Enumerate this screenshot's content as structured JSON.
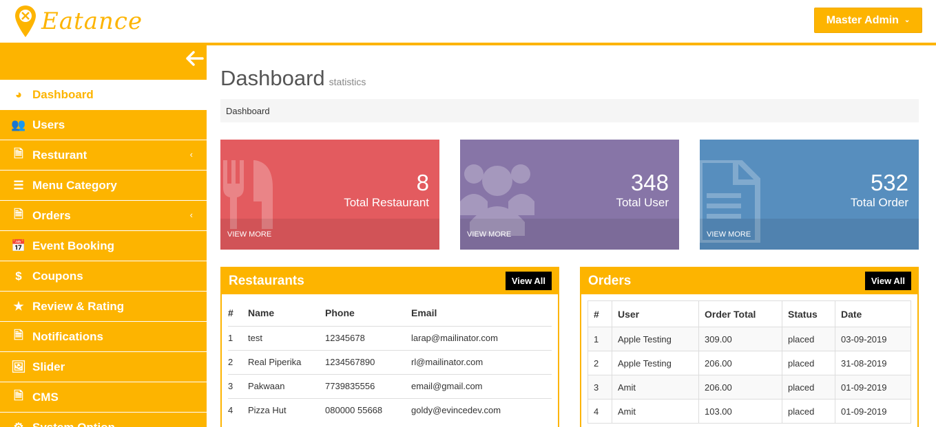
{
  "brand": {
    "name": "Eatance",
    "accent": "#fdb400"
  },
  "header": {
    "admin_label": "Master Admin",
    "admin_caret": "⌄"
  },
  "sidebar": {
    "toggle_icon": "arrow-left-icon",
    "items": [
      {
        "label": "Dashboard",
        "icon": "◕",
        "active": true
      },
      {
        "label": "Users",
        "icon": "👥"
      },
      {
        "label": "Resturant",
        "icon": "🗎",
        "chevron": "‹"
      },
      {
        "label": "Menu Category",
        "icon": "☰"
      },
      {
        "label": "Orders",
        "icon": "🗎",
        "chevron": "‹"
      },
      {
        "label": "Event Booking",
        "icon": "📅"
      },
      {
        "label": "Coupons",
        "icon": "$"
      },
      {
        "label": "Review & Rating",
        "icon": "★"
      },
      {
        "label": "Notifications",
        "icon": "🗎"
      },
      {
        "label": "Slider",
        "icon": "🖼"
      },
      {
        "label": "CMS",
        "icon": "🗎"
      },
      {
        "label": "System Option",
        "icon": "⚙"
      }
    ]
  },
  "page": {
    "title": "Dashboard",
    "subtitle": "statistics",
    "breadcrumb": "Dashboard"
  },
  "stats": [
    {
      "value": "8",
      "label": "Total Restaurant",
      "more": "VIEW MORE",
      "color": "#e35b5f"
    },
    {
      "value": "348",
      "label": "Total User",
      "more": "VIEW MORE",
      "color": "#8775a7"
    },
    {
      "value": "532",
      "label": "Total Order",
      "more": "VIEW MORE",
      "color": "#578ebe"
    }
  ],
  "restaurants": {
    "title": "Restaurants",
    "view_all": "View All",
    "columns": [
      "#",
      "Name",
      "Phone",
      "Email"
    ],
    "rows": [
      [
        "1",
        "test",
        "12345678",
        "larap@mailinator.com"
      ],
      [
        "2",
        "Real Piperika",
        "1234567890",
        "rl@mailinator.com"
      ],
      [
        "3",
        "Pakwaan",
        "7739835556",
        "email@gmail.com"
      ],
      [
        "4",
        "Pizza Hut",
        "080000 55668",
        "goldy@evincedev.com"
      ]
    ]
  },
  "orders": {
    "title": "Orders",
    "view_all": "View All",
    "columns": [
      "#",
      "User",
      "Order Total",
      "Status",
      "Date"
    ],
    "rows": [
      [
        "1",
        "Apple Testing",
        "309.00",
        "placed",
        "03-09-2019"
      ],
      [
        "2",
        "Apple Testing",
        "206.00",
        "placed",
        "31-08-2019"
      ],
      [
        "3",
        "Amit",
        "206.00",
        "placed",
        "01-09-2019"
      ],
      [
        "4",
        "Amit",
        "103.00",
        "placed",
        "01-09-2019"
      ]
    ]
  }
}
